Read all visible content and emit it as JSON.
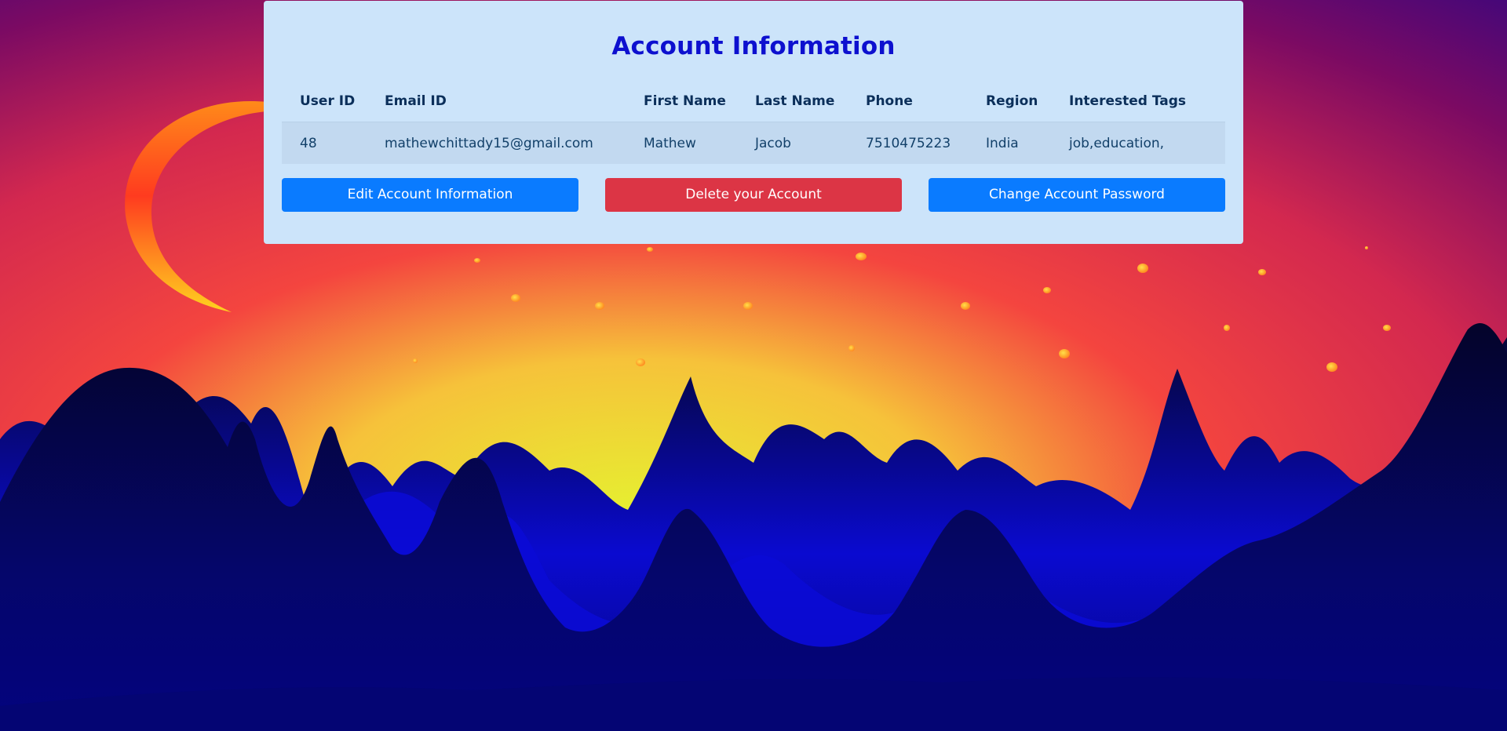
{
  "account": {
    "title": "Account Information",
    "columns": [
      "User ID",
      "Email ID",
      "First Name",
      "Last Name",
      "Phone",
      "Region",
      "Interested Tags"
    ],
    "row": {
      "user_id": "48",
      "email": "mathewchittady15@gmail.com",
      "first_name": "Mathew",
      "last_name": "Jacob",
      "phone": "7510475223",
      "region": "India",
      "tags": "job,education,"
    }
  },
  "actions": {
    "edit_label": "Edit Account Information",
    "delete_label": "Delete your Account",
    "password_label": "Change Account Password"
  },
  "colors": {
    "primary": "#0a7bff",
    "danger": "#dc3545",
    "title": "#0d10cf",
    "card_bg": "#cce4fa"
  },
  "background": {
    "moon_icon": "crescent-moon-icon",
    "theme": "sunset mountains"
  }
}
